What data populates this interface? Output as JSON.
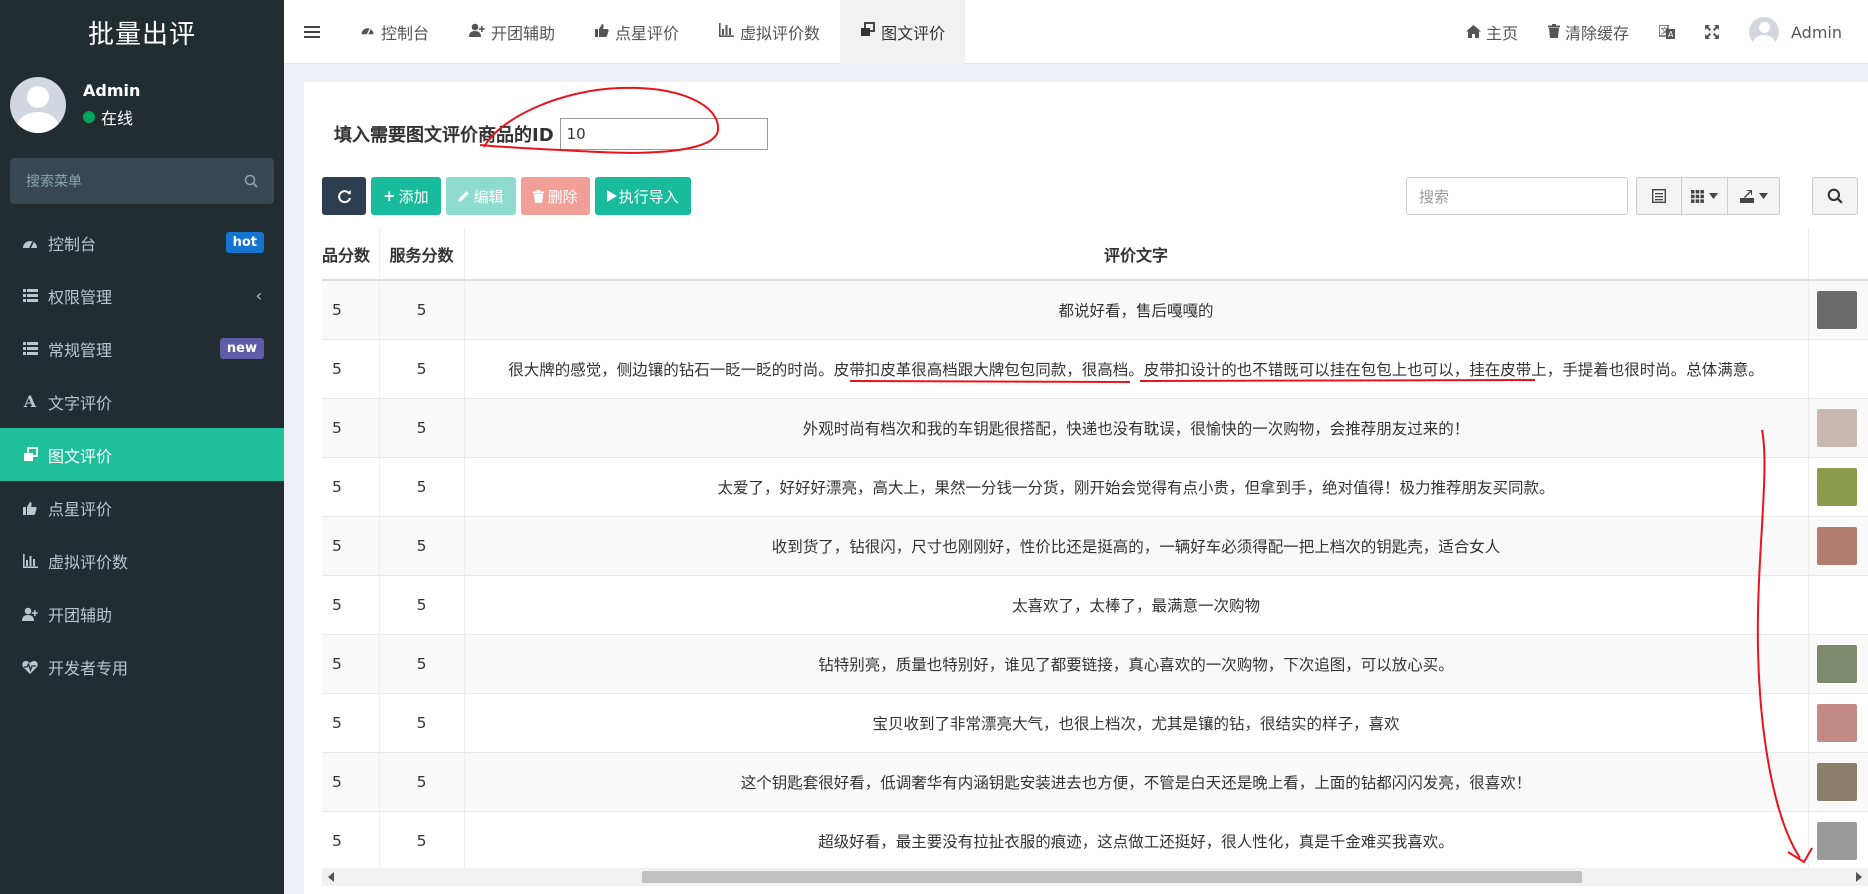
{
  "sidebar": {
    "brand": "批量出评",
    "user": {
      "name": "Admin",
      "status": "在线"
    },
    "search_placeholder": "搜索菜单",
    "items": [
      {
        "label": "控制台",
        "icon": "dashboard-icon",
        "badge": "hot"
      },
      {
        "label": "权限管理",
        "icon": "list-icon",
        "chevron": "‹"
      },
      {
        "label": "常规管理",
        "icon": "list-icon",
        "badge": "new"
      },
      {
        "label": "文字评价",
        "icon": "font-icon"
      },
      {
        "label": "图文评价",
        "icon": "clone-icon",
        "active": true
      },
      {
        "label": "点星评价",
        "icon": "thumbs-up-icon"
      },
      {
        "label": "虚拟评价数",
        "icon": "bar-chart-icon"
      },
      {
        "label": "开团辅助",
        "icon": "user-plus-icon"
      },
      {
        "label": "开发者专用",
        "icon": "heartbeat-icon"
      }
    ]
  },
  "topbar": {
    "tabs": [
      {
        "label": "控制台",
        "icon": "dashboard-icon"
      },
      {
        "label": "开团辅助",
        "icon": "user-plus-icon"
      },
      {
        "label": "点星评价",
        "icon": "thumbs-up-icon"
      },
      {
        "label": "虚拟评价数",
        "icon": "bar-chart-icon"
      },
      {
        "label": "图文评价",
        "icon": "clone-icon",
        "active": true
      }
    ],
    "right": {
      "home": "主页",
      "clear_cache": "清除缓存",
      "user": "Admin"
    }
  },
  "form": {
    "id_label": "填入需要图文评价商品的ID",
    "id_value": "10"
  },
  "toolbar": {
    "add": "添加",
    "edit": "编辑",
    "delete": "删除",
    "import": "执行导入",
    "search_placeholder": "搜索"
  },
  "table": {
    "headers": [
      "品分数",
      "服务分数",
      "评价文字",
      ""
    ],
    "rows": [
      {
        "score": "5",
        "service": "5",
        "text": "都说好看，售后嘎嘎的",
        "thumb": "#6b6b6b"
      },
      {
        "score": "5",
        "service": "5",
        "text": "很大牌的感觉，侧边镶的钻石一眨一眨的时尚。皮带扣皮革很高档跟大牌包包同款，很高档。皮带扣设计的也不错既可以挂在包包上也可以，挂在皮带上，手提着也很时尚。总体满意。",
        "thumb": ""
      },
      {
        "score": "5",
        "service": "5",
        "text": "外观时尚有档次和我的车钥匙很搭配，快递也没有耽误，很愉快的一次购物，会推荐朋友过来的！",
        "thumb": "#c9b8b0"
      },
      {
        "score": "5",
        "service": "5",
        "text": "太爱了，好好好漂亮，高大上，果然一分钱一分货，刚开始会觉得有点小贵，但拿到手，绝对值得！极力推荐朋友买同款。",
        "thumb": "#8c9a4c"
      },
      {
        "score": "5",
        "service": "5",
        "text": "收到货了，钻很闪，尺寸也刚刚好，性价比还是挺高的，一辆好车必须得配一把上档次的钥匙壳，适合女人",
        "thumb": "#b07d70"
      },
      {
        "score": "5",
        "service": "5",
        "text": "太喜欢了，太棒了，最满意一次购物",
        "thumb": ""
      },
      {
        "score": "5",
        "service": "5",
        "text": "钻特别亮，质量也特别好，谁见了都要链接，真心喜欢的一次购物，下次追图，可以放心买。",
        "thumb": "#7d8a6e"
      },
      {
        "score": "5",
        "service": "5",
        "text": "宝贝收到了非常漂亮大气，也很上档次，尤其是镶的钻，很结实的样子，喜欢",
        "thumb": "#c48a86"
      },
      {
        "score": "5",
        "service": "5",
        "text": "这个钥匙套很好看，低调奢华有内涵钥匙安装进去也方便，不管是白天还是晚上看，上面的钻都闪闪发亮，很喜欢！",
        "thumb": "#8a7f6a"
      },
      {
        "score": "5",
        "service": "5",
        "text": "超级好看，最主要没有拉扯衣服的痕迹，这点做工还挺好，很人性化，真是千金难买我喜欢。",
        "thumb": "#9a9a9a"
      }
    ]
  },
  "colors": {
    "sidebar_bg": "#222d32",
    "active": "#1fbf9c",
    "btn_green": "#18bc9c",
    "btn_dark": "#2c3e50",
    "annotation": "#e8141b"
  }
}
